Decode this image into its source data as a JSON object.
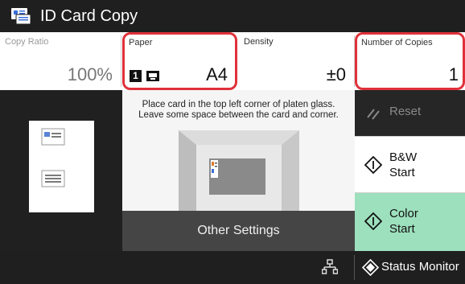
{
  "title_bar": {
    "title": "ID Card Copy",
    "icon": "id-card-copy-icon"
  },
  "settings": {
    "copy_ratio": {
      "label": "Copy Ratio",
      "value": "100%"
    },
    "paper": {
      "label": "Paper",
      "tray": "1",
      "tray_icon": "paper-drawer-icon",
      "value": "A4"
    },
    "density": {
      "label": "Density",
      "value": "±0"
    },
    "copies": {
      "label": "Number of Copies",
      "value": "1"
    }
  },
  "preview": {
    "page_icon": "page-preview-icon"
  },
  "instruction": {
    "line1": "Place card in the top left corner of platen glass.",
    "line2": "Leave some space between the card and corner."
  },
  "buttons": {
    "other_settings": "Other Settings",
    "reset": "Reset",
    "bw_line1": "B&W",
    "bw_line2": "Start",
    "color_line1": "Color",
    "color_line2": "Start"
  },
  "bottom_bar": {
    "status_monitor": "Status Monitor",
    "network_icon": "network-icon"
  },
  "colors": {
    "dark_bar": "#1f1f1f",
    "highlight": "#e0313a",
    "color_start": "#9de0bd",
    "other_settings_bg": "#454545"
  }
}
